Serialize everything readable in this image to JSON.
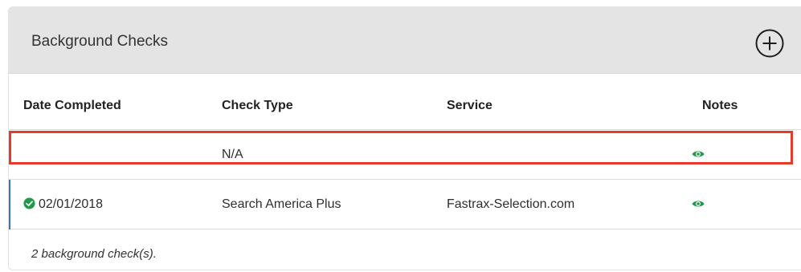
{
  "card": {
    "title": "Background Checks",
    "add_icon": "plus-circle-icon"
  },
  "table": {
    "columns": [
      "Date Completed",
      "Check Type",
      "Service",
      "Notes"
    ],
    "rows": [
      {
        "date": "",
        "check_type": "N/A",
        "service": "",
        "notes_icon": "eye-icon",
        "status_icon": ""
      },
      {
        "date": "02/01/2018",
        "check_type": "Search America Plus",
        "service": "Fastrax-Selection.com",
        "notes_icon": "eye-icon",
        "status_icon": "check-circle-icon"
      }
    ]
  },
  "footer": {
    "summary": "2 background check(s)."
  },
  "colors": {
    "header_bg": "#e4e4e4",
    "eye_icon": "#1f9a4a",
    "check_icon": "#1f9a4a",
    "row_accent": "#3f6fc0",
    "highlight_border": "#e43b2c"
  }
}
